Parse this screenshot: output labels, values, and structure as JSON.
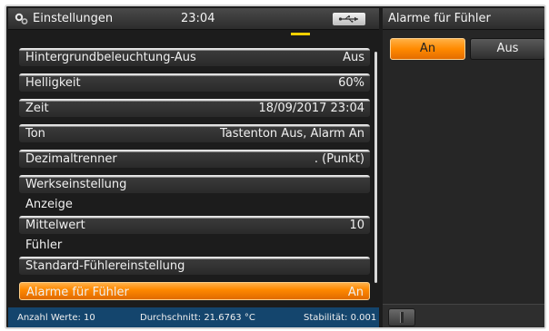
{
  "header": {
    "title": "Einstellungen",
    "time": "23:04",
    "icon": "gear-icon",
    "usb_icon": "usb-icon"
  },
  "settings": {
    "items": [
      {
        "label": "Hintergrundbeleuchtung-Aus",
        "value": "Aus"
      },
      {
        "label": "Helligkeit",
        "value": "60%"
      },
      {
        "label": "Zeit",
        "value": "18/09/2017 23:04"
      },
      {
        "label": "Ton",
        "value": "Tastenton Aus, Alarm An"
      },
      {
        "label": "Dezimaltrenner",
        "value": ". (Punkt)"
      },
      {
        "label": "Werkseinstellung",
        "value": ""
      },
      {
        "label": "Mittelwert",
        "value": "10"
      },
      {
        "label": "Standard-Fühlereinstellung",
        "value": ""
      },
      {
        "label": "Alarme für Fühler",
        "value": "An"
      }
    ],
    "sections": {
      "anzeige": "Anzeige",
      "fuehler": "Fühler"
    }
  },
  "status": {
    "count": "Anzahl Werte: 10",
    "average": "Durchschnitt: 21.6763 °C",
    "stability": "Stabilität: 0.001"
  },
  "detail": {
    "title": "Alarme für Fühler",
    "options": [
      "An",
      "Aus"
    ],
    "selected": "An"
  },
  "colors": {
    "accent": "#ff8a00",
    "status_bar": "#14456d",
    "scroll_marker": "#f2d000"
  }
}
